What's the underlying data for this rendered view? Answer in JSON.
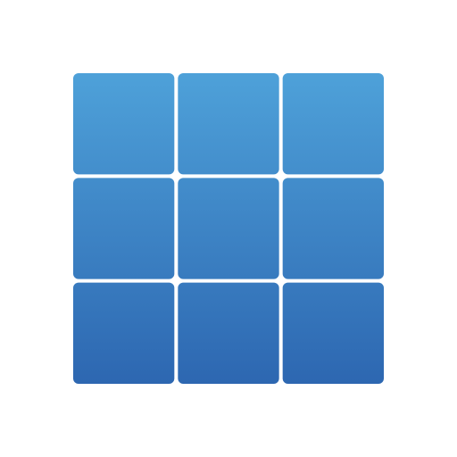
{
  "icon": {
    "name": "grid-3x3-icon",
    "rows": 3,
    "columns": 3,
    "gradient_top_color": "#4ea1d9",
    "gradient_bottom_color": "#2d67b1"
  }
}
